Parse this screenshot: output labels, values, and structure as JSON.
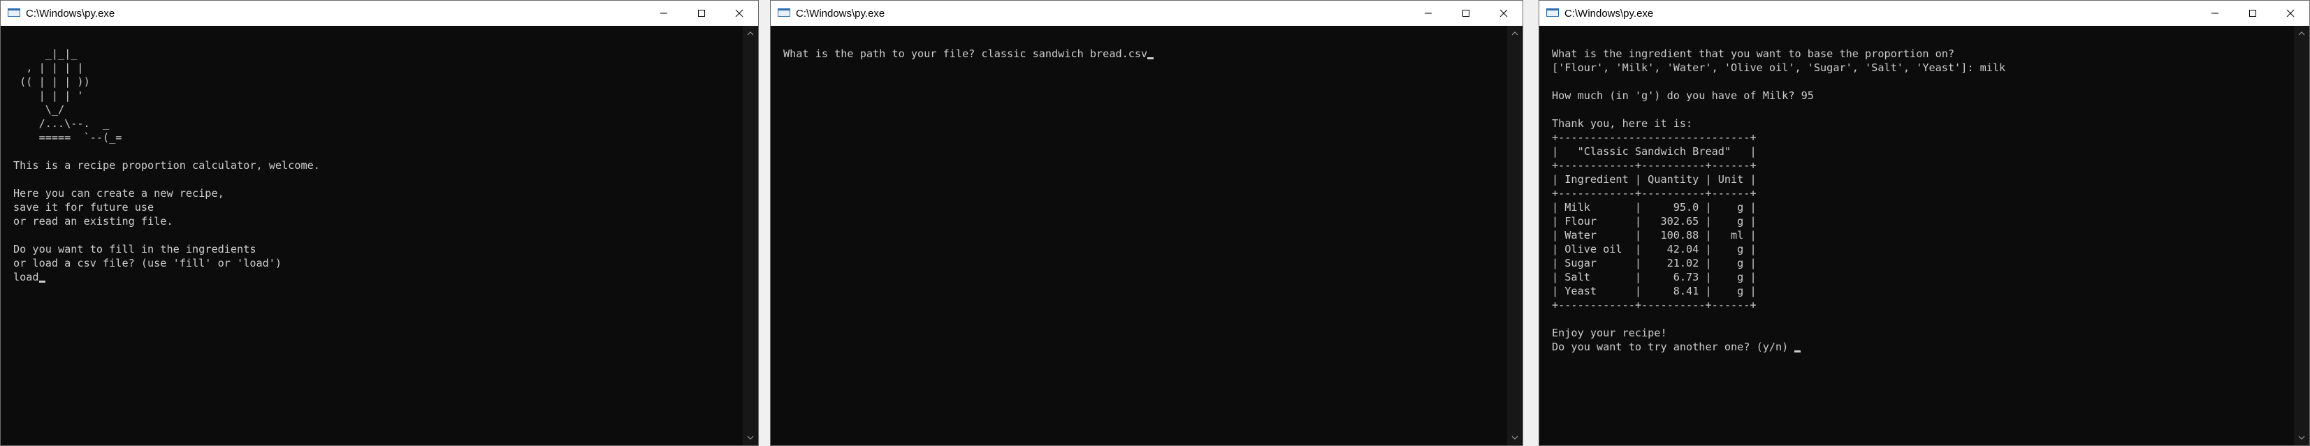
{
  "windows": [
    {
      "title": "C:\\Windows\\py.exe",
      "lines": [
        "",
        "     _|_|_",
        "  , | | | |",
        " (( | | | ))",
        "    | | | '",
        "     \\_/",
        "    /...\\--.  _",
        "    =====  `--(_=",
        "",
        "This is a recipe proportion calculator, welcome.",
        "",
        "Here you can create a new recipe,",
        "save it for future use",
        "or read an existing file.",
        "",
        "Do you want to fill in the ingredients",
        "or load a csv file? (use 'fill' or 'load')",
        "load"
      ]
    },
    {
      "title": "C:\\Windows\\py.exe",
      "lines": [
        "",
        "What is the path to your file? classic sandwich bread.csv"
      ]
    },
    {
      "title": "C:\\Windows\\py.exe",
      "lines": [
        "",
        "What is the ingredient that you want to base the proportion on?",
        "['Flour', 'Milk', 'Water', 'Olive oil', 'Sugar', 'Salt', 'Yeast']: milk",
        "",
        "How much (in 'g') do you have of Milk? 95",
        "",
        "Thank you, here it is:",
        "+------------------------------+",
        "|   \"Classic Sandwich Bread\"   |",
        "+------------+----------+------+",
        "| Ingredient | Quantity | Unit |",
        "+------------+----------+------+",
        "| Milk       |     95.0 |    g |",
        "| Flour      |   302.65 |    g |",
        "| Water      |   100.88 |   ml |",
        "| Olive oil  |    42.04 |    g |",
        "| Sugar      |    21.02 |    g |",
        "| Salt       |     6.73 |    g |",
        "| Yeast      |     8.41 |    g |",
        "+------------+----------+------+",
        "",
        "Enjoy your recipe!",
        "Do you want to try another one? (y/n) "
      ]
    }
  ],
  "icons": {
    "app": "console-app-icon",
    "minimize": "minimize-icon",
    "maximize": "maximize-icon",
    "close": "close-icon"
  },
  "colors": {
    "console_bg": "#0c0c0c",
    "console_text": "#cccccc",
    "titlebar_bg": "#ffffff"
  }
}
